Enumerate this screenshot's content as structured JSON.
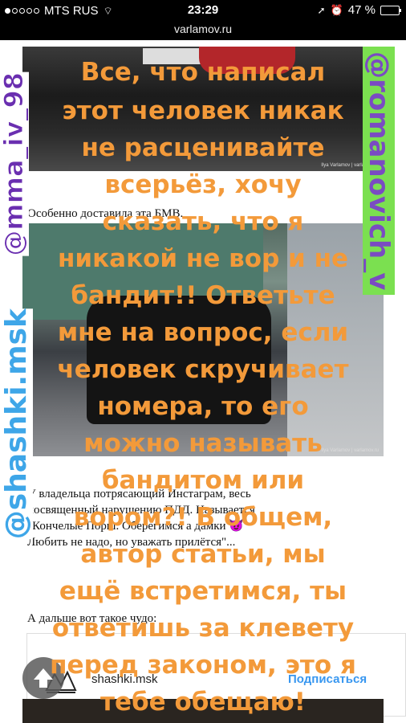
{
  "status_bar": {
    "carrier": "MTS RUS",
    "time": "23:29",
    "battery": "47 %",
    "battery_level": 0.47
  },
  "url_bar": {
    "domain": "varlamov.ru"
  },
  "article": {
    "text1": "Особенно доставила эта БМВ.",
    "text2_lines": [
      "У владельца потрясающий Инстаграм, весь",
      "посвященный нарушению ПДД. Называется",
      "\"Кончелые Порш. Оберегимся а дамки 😈",
      "Любить не надо, но уважать прилётся\"..."
    ],
    "text3": "А дальше вот такое чудо:",
    "photo_credit": "Ilya Varlamov | varlamov.ru"
  },
  "insta": {
    "username": "shashki.msk",
    "follow_label": "Подписаться"
  },
  "stickers": {
    "mma": "@mma_iv_98",
    "romanovich": "@romanovich_v",
    "shashki": "@shashki.msk"
  },
  "overlay_lines": [
    "Все, что написал",
    "этот человек никак",
    "не расценивайте",
    "всерьёз, хочу",
    "сказать, что я",
    "никакой не вор и не",
    "бандит!! Ответьте",
    "мне на вопрос, если",
    "человек скручивает",
    "номера, то его",
    "можно называть",
    "бандитом или",
    "вором?! В общем,",
    "автор статьи, мы",
    "ещё встретимся, ты",
    "ответишь за клевету",
    "перед законом, это я",
    "тебе обещаю!"
  ],
  "colors": {
    "overlay_text": "#f39a3a",
    "follow": "#3897f0",
    "romanovich_bg": "#7be050"
  }
}
